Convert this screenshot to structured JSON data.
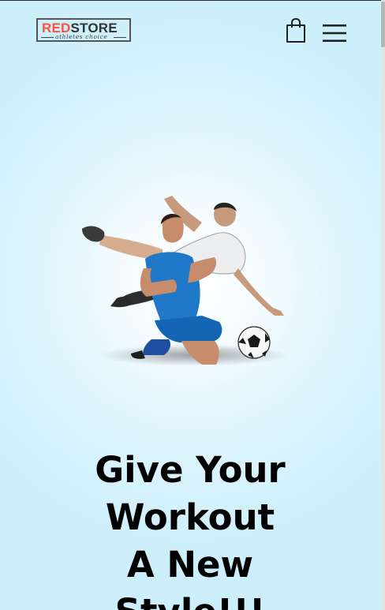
{
  "header": {
    "logo": {
      "brand_red": "RED",
      "brand_dark": "STORE",
      "tagline": "athletes choice"
    },
    "cart_icon": "shopping-bag-icon",
    "menu_icon": "hamburger-menu-icon"
  },
  "hero": {
    "image": "football-players-image",
    "headline_lines": [
      "Give Your",
      "Workout",
      "A New",
      "Style!!!"
    ]
  },
  "colors": {
    "accent": "#ff523b",
    "text": "#000000",
    "background": "#d9f3fc"
  }
}
